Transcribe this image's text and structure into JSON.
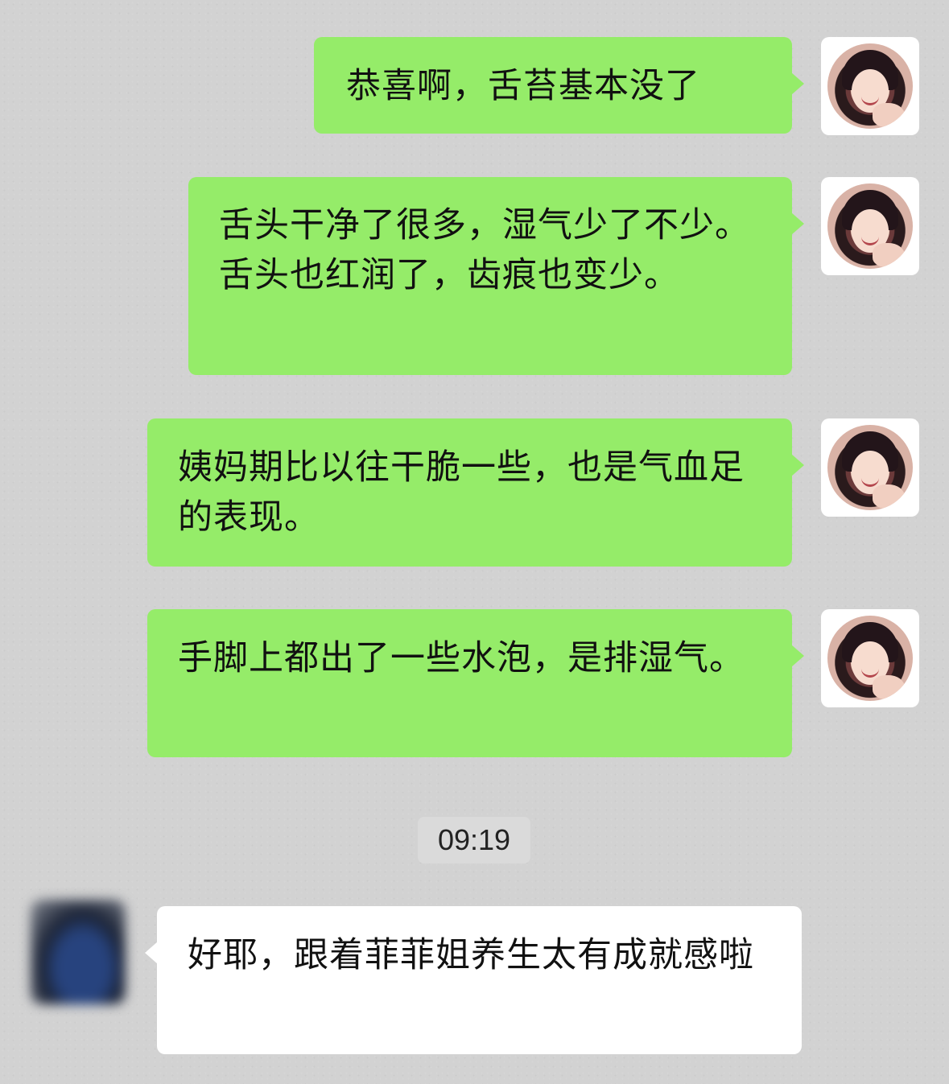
{
  "messages": [
    {
      "direction": "out",
      "text": "恭喜啊，舌苔基本没了"
    },
    {
      "direction": "out",
      "text": "舌头干净了很多，湿气少了不少。舌头也红润了，齿痕也变少。"
    },
    {
      "direction": "out",
      "text": "姨妈期比以往干脆一些，也是气血足的表现。"
    },
    {
      "direction": "out",
      "text": "手脚上都出了一些水泡，是排湿气。"
    },
    {
      "direction": "in",
      "text": "好耶，跟着菲菲姐养生太有成就感啦"
    }
  ],
  "timestamp": "09:19",
  "colors": {
    "outgoing_bubble": "#95ec69",
    "incoming_bubble": "#ffffff",
    "chat_background": "#d2d2d2"
  },
  "icons": {
    "self_avatar": "avatar-woman-photo",
    "contact_avatar": "avatar-blurred"
  }
}
